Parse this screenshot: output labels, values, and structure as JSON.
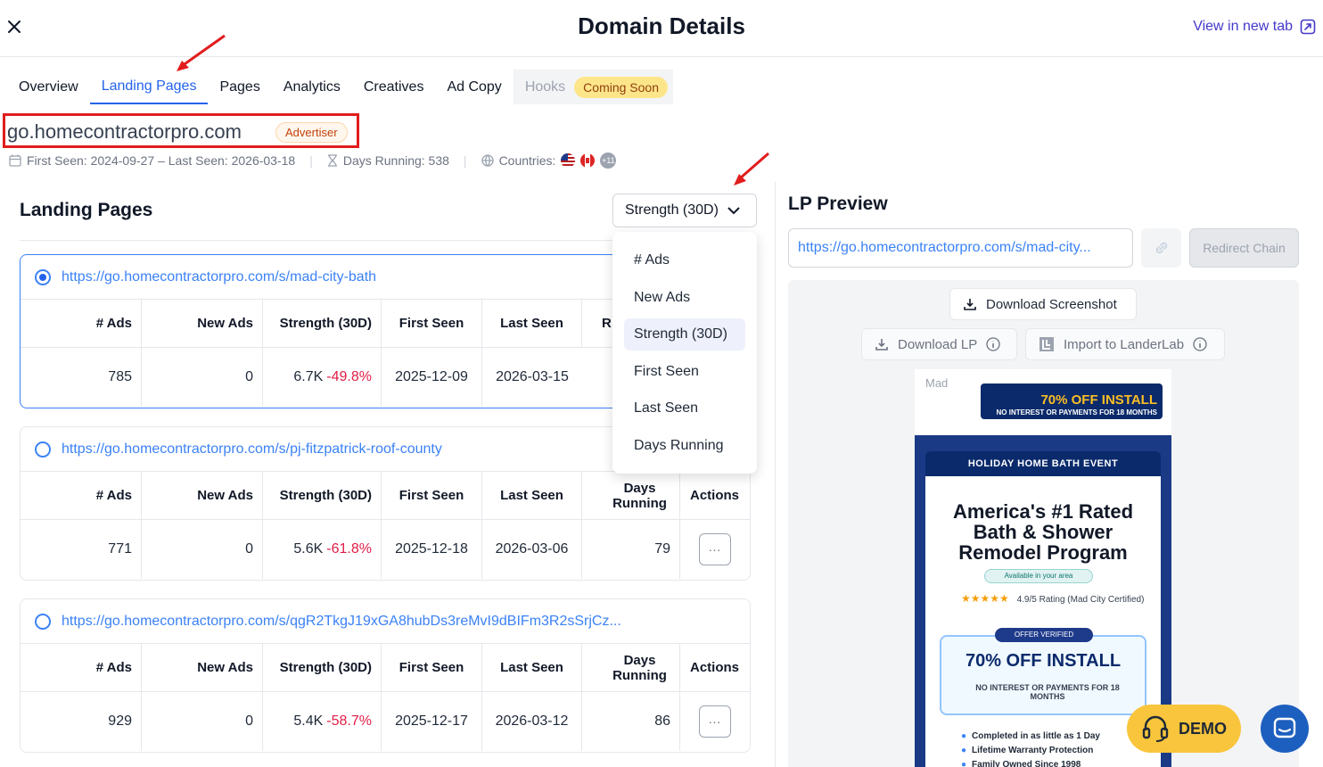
{
  "header": {
    "title": "Domain Details",
    "view_new_tab": "View in new tab"
  },
  "tabs": [
    {
      "label": "Overview"
    },
    {
      "label": "Landing Pages"
    },
    {
      "label": "Pages"
    },
    {
      "label": "Analytics"
    },
    {
      "label": "Creatives"
    },
    {
      "label": "Ad Copy"
    },
    {
      "label": "Hooks",
      "badge": "Coming Soon"
    }
  ],
  "domain": {
    "name": "go.homecontractorpro.com",
    "badge": "Advertiser",
    "seen": "First Seen: 2024-09-27 – Last Seen: 2026-03-18",
    "days_running": "Days Running: 538",
    "countries_label": "Countries:",
    "countries_more": "+11"
  },
  "landing_pages": {
    "heading": "Landing Pages",
    "sort_label": "Strength (30D)",
    "sort_options": [
      "# Ads",
      "New Ads",
      "Strength (30D)",
      "First Seen",
      "Last Seen",
      "Days Running"
    ],
    "columns": [
      "# Ads",
      "New Ads",
      "Strength (30D)",
      "First Seen",
      "Last Seen",
      "Days Running",
      "Actions"
    ],
    "truncated_col": "R",
    "actions_glyph": "···",
    "rows": [
      {
        "url": "https://go.homecontractorpro.com/s/mad-city-bath",
        "ads": "785",
        "new_ads": "0",
        "strength": "6.7K",
        "change": "-49.8%",
        "first_seen": "2025-12-09",
        "last_seen": "2026-03-15"
      },
      {
        "url": "https://go.homecontractorpro.com/s/pj-fitzpatrick-roof-county",
        "ads": "771",
        "new_ads": "0",
        "strength": "5.6K",
        "change": "-61.8%",
        "first_seen": "2025-12-18",
        "last_seen": "2026-03-06",
        "days": "79"
      },
      {
        "url": "https://go.homecontractorpro.com/s/qgR2TkgJ19xGA8hubDs3reMvI9dBIFm3R2sSrjCz...",
        "ads": "929",
        "new_ads": "0",
        "strength": "5.4K",
        "change": "-58.7%",
        "first_seen": "2025-12-17",
        "last_seen": "2026-03-12",
        "days": "86"
      }
    ]
  },
  "preview": {
    "title": "LP Preview",
    "url": "https://go.homecontractorpro.com/s/mad-city...",
    "redirect_chain": "Redirect Chain",
    "download_screenshot": "Download Screenshot",
    "download_lp": "Download LP",
    "import": "Import to LanderLab",
    "shot": {
      "alt": "Mad",
      "banner_main": "70% OFF INSTALL",
      "banner_sub": "NO INTEREST OR PAYMENTS FOR 18 MONTHS",
      "event": "HOLIDAY HOME BATH EVENT",
      "headline_1": "America's #1 Rated",
      "headline_2": "Bath & Shower",
      "headline_3": "Remodel Program",
      "availability": "Available in your area",
      "stars": "★★★★★",
      "rating": "4.9/5 Rating (Mad City Certified)",
      "verified": "OFFER VERIFIED",
      "offer": "70% OFF INSTALL",
      "offer_sub": "NO INTEREST OR PAYMENTS FOR 18 MONTHS",
      "bullets": [
        "Completed in as little as 1 Day",
        "Lifetime Warranty Protection",
        "Family Owned Since 1998"
      ]
    }
  },
  "floating": {
    "demo": "DEMO"
  },
  "colors": {
    "accent": "#2563eb",
    "negative": "#e11d48",
    "demo": "#f8c53c",
    "chat": "#1d5fbf",
    "annotation": "#e11d1d"
  }
}
